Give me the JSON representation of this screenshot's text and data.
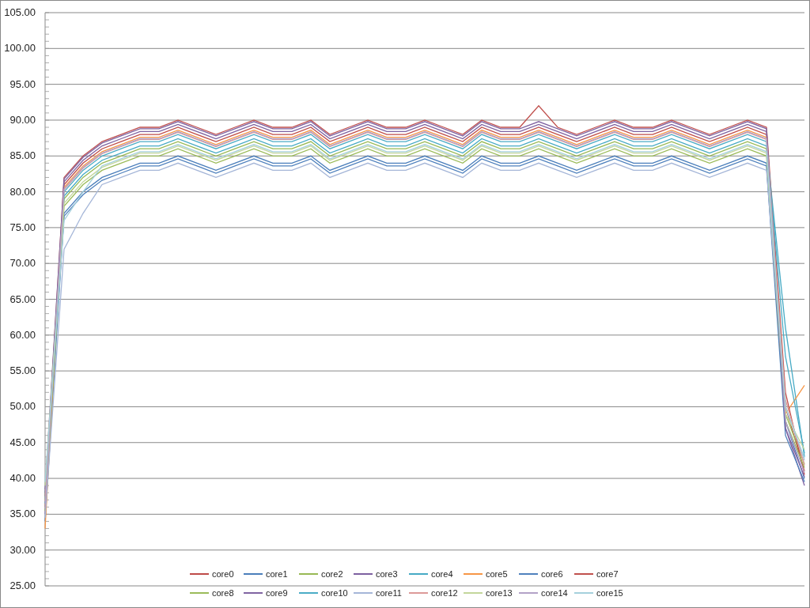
{
  "chart": {
    "chart_data": {
      "type": "line",
      "grid": true,
      "legend": true,
      "ylim": [
        25,
        105
      ],
      "yticks": [
        {
          "value": 25,
          "label": "25.00"
        },
        {
          "value": 30,
          "label": "30.00"
        },
        {
          "value": 35,
          "label": "35.00"
        },
        {
          "value": 40,
          "label": "40.00"
        },
        {
          "value": 45,
          "label": "45.00"
        },
        {
          "value": 50,
          "label": "50.00"
        },
        {
          "value": 55,
          "label": "55.00"
        },
        {
          "value": 60,
          "label": "60.00"
        },
        {
          "value": 65,
          "label": "65.00"
        },
        {
          "value": 70,
          "label": "70.00"
        },
        {
          "value": 75,
          "label": "75.00"
        },
        {
          "value": 80,
          "label": "80.00"
        },
        {
          "value": 85,
          "label": "85.00"
        },
        {
          "value": 90,
          "label": "90.00"
        },
        {
          "value": 95,
          "label": "95.00"
        },
        {
          "value": 100,
          "label": "100.00"
        },
        {
          "value": 105,
          "label": "105.00"
        }
      ],
      "series": [
        {
          "name": "core0",
          "color": "#be4b48",
          "values": [
            36,
            81,
            84,
            86,
            87,
            88,
            88,
            89,
            88,
            87,
            88,
            89,
            88,
            88,
            89,
            87,
            88,
            89,
            88,
            88,
            89,
            88,
            87,
            89,
            88,
            88,
            89,
            88,
            87,
            88,
            89,
            88,
            88,
            89,
            88,
            87,
            88,
            89,
            88,
            50,
            41
          ]
        },
        {
          "name": "core1",
          "color": "#4a7ebb",
          "values": [
            34,
            77,
            80,
            82,
            83,
            84,
            84,
            85,
            84,
            83,
            84,
            85,
            84,
            84,
            85,
            83,
            84,
            85,
            84,
            84,
            85,
            84,
            83,
            85,
            84,
            84,
            85,
            84,
            83,
            84,
            85,
            84,
            84,
            85,
            84,
            83,
            84,
            85,
            84,
            48,
            40
          ]
        },
        {
          "name": "core2",
          "color": "#98b954",
          "values": [
            37,
            79,
            82,
            84,
            85,
            86,
            86,
            87,
            86,
            85,
            86,
            87,
            86,
            86,
            87,
            85,
            86,
            87,
            86,
            86,
            87,
            86,
            85,
            87,
            86,
            86,
            87,
            86,
            85,
            86,
            87,
            86,
            86,
            87,
            86,
            85,
            86,
            87,
            86,
            49,
            42
          ]
        },
        {
          "name": "core3",
          "color": "#7d60a0",
          "values": [
            35,
            81.4,
            84.4,
            86.4,
            87.4,
            88.4,
            88.4,
            89.4,
            88.4,
            87.4,
            88.4,
            89.4,
            88.4,
            88.4,
            89.4,
            87.4,
            88.4,
            89.4,
            88.4,
            88.4,
            89.4,
            88.4,
            87.4,
            89.4,
            88.4,
            88.4,
            89.4,
            88.4,
            87.4,
            88.4,
            89.4,
            88.4,
            88.4,
            89.4,
            88.4,
            87.4,
            88.4,
            89.4,
            88.4,
            47,
            39
          ]
        },
        {
          "name": "core4",
          "color": "#46aac5",
          "values": [
            36.5,
            79.4,
            82.4,
            84.4,
            85.4,
            86.4,
            86.4,
            87.4,
            86.4,
            85.4,
            86.4,
            87.4,
            86.4,
            86.4,
            87.4,
            85.4,
            86.4,
            87.4,
            86.4,
            86.4,
            87.4,
            86.4,
            85.4,
            87.4,
            86.4,
            86.4,
            87.4,
            86.4,
            85.4,
            86.4,
            87.4,
            86.4,
            86.4,
            87.4,
            86.4,
            85.4,
            86.4,
            87.4,
            86.4,
            61,
            43
          ]
        },
        {
          "name": "core5",
          "color": "#f79646",
          "values": [
            33,
            80.6,
            83.6,
            85.6,
            86.6,
            87.6,
            87.6,
            88.6,
            87.6,
            86.6,
            87.6,
            88.6,
            87.6,
            87.6,
            88.6,
            86.6,
            87.6,
            88.6,
            87.6,
            87.6,
            88.6,
            87.6,
            86.6,
            88.6,
            87.6,
            87.6,
            88.6,
            87.6,
            86.6,
            87.6,
            88.6,
            87.6,
            87.6,
            88.6,
            87.6,
            86.6,
            87.6,
            88.6,
            87.6,
            49,
            53
          ]
        },
        {
          "name": "core6",
          "color": "#4f81bd",
          "values": [
            38,
            76.6,
            79.6,
            81.6,
            82.6,
            83.6,
            83.6,
            84.6,
            83.6,
            82.6,
            83.6,
            84.6,
            83.6,
            83.6,
            84.6,
            82.6,
            83.6,
            84.6,
            83.6,
            83.6,
            84.6,
            83.6,
            82.6,
            84.6,
            83.6,
            83.6,
            84.6,
            83.6,
            82.6,
            83.6,
            84.6,
            83.6,
            83.6,
            84.6,
            83.6,
            82.6,
            83.6,
            84.6,
            83.6,
            46,
            39.5
          ]
        },
        {
          "name": "core7",
          "color": "#c0504d",
          "values": [
            37.5,
            82,
            85,
            87,
            88,
            89,
            89,
            90,
            89,
            88,
            89,
            90,
            89,
            89,
            90,
            88,
            89,
            90,
            89,
            89,
            90,
            89,
            88,
            90,
            89,
            89,
            92,
            89,
            88,
            89,
            90,
            89,
            89,
            90,
            89,
            88,
            89,
            90,
            89,
            52,
            40.5
          ]
        },
        {
          "name": "core8",
          "color": "#9bbb59",
          "values": [
            35.5,
            78,
            81,
            83,
            84,
            85,
            85,
            86,
            85,
            84,
            85,
            86,
            85,
            85,
            86,
            84,
            85,
            86,
            85,
            85,
            86,
            85,
            84,
            86,
            85,
            85,
            86,
            85,
            84,
            85,
            86,
            85,
            85,
            86,
            85,
            84,
            85,
            86,
            85,
            48,
            41.5
          ]
        },
        {
          "name": "core9",
          "color": "#8064a2",
          "values": [
            38.5,
            81.8,
            84.8,
            86.8,
            87.8,
            88.8,
            88.8,
            89.8,
            88.8,
            87.8,
            88.8,
            89.8,
            88.8,
            88.8,
            89.8,
            87.8,
            88.8,
            89.8,
            88.8,
            88.8,
            89.8,
            88.8,
            87.8,
            89.8,
            88.8,
            88.8,
            89.8,
            88.8,
            87.8,
            88.8,
            89.8,
            88.8,
            88.8,
            89.8,
            88.8,
            87.8,
            88.8,
            89.8,
            88.8,
            47,
            40.2
          ]
        },
        {
          "name": "core10",
          "color": "#4bacc6",
          "values": [
            37.2,
            80,
            83,
            85,
            86,
            87,
            87,
            88,
            87,
            86,
            87,
            88,
            87,
            87,
            88,
            86,
            87,
            88,
            87,
            87,
            88,
            87,
            86,
            88,
            87,
            87,
            88,
            87,
            86,
            87,
            88,
            87,
            87,
            88,
            87,
            86,
            87,
            88,
            87,
            57,
            43.5
          ]
        },
        {
          "name": "core11",
          "color": "#a5b6d8",
          "values": [
            34.5,
            72,
            77,
            81,
            82,
            83,
            83,
            84,
            83,
            82,
            83,
            84,
            83,
            83,
            84,
            82,
            83,
            84,
            83,
            83,
            84,
            83,
            82,
            84,
            83,
            83,
            84,
            83,
            82,
            83,
            84,
            83,
            83,
            84,
            83,
            82,
            83,
            84,
            83,
            50,
            42.5
          ]
        },
        {
          "name": "core12",
          "color": "#dc9a98",
          "values": [
            36.8,
            80.3,
            83.3,
            85.3,
            86.3,
            87.3,
            87.3,
            88.3,
            87.3,
            86.3,
            87.3,
            88.3,
            87.3,
            87.3,
            88.3,
            86.3,
            87.3,
            88.3,
            87.3,
            87.3,
            88.3,
            87.3,
            86.3,
            88.3,
            87.3,
            87.3,
            88.3,
            87.3,
            86.3,
            87.3,
            88.3,
            87.3,
            87.3,
            88.3,
            87.3,
            86.3,
            87.3,
            88.3,
            87.3,
            51,
            41.8
          ]
        },
        {
          "name": "core13",
          "color": "#c3d69b",
          "values": [
            39,
            78.4,
            81.4,
            83.4,
            84.4,
            85.4,
            85.4,
            86.4,
            85.4,
            84.4,
            85.4,
            86.4,
            85.4,
            85.4,
            86.4,
            84.4,
            85.4,
            86.4,
            85.4,
            85.4,
            86.4,
            85.4,
            84.4,
            86.4,
            85.4,
            85.4,
            86.4,
            85.4,
            84.4,
            85.4,
            86.4,
            85.4,
            85.4,
            86.4,
            85.4,
            84.4,
            85.4,
            86.4,
            85.4,
            49,
            44
          ]
        },
        {
          "name": "core14",
          "color": "#b3a2c7",
          "values": [
            35.8,
            80.4,
            83.4,
            85.4,
            86.4,
            87.4,
            87.4,
            88.4,
            87.4,
            86.4,
            87.4,
            88.4,
            87.4,
            87.4,
            88.4,
            86.4,
            87.4,
            88.4,
            87.4,
            87.4,
            88.4,
            87.4,
            86.4,
            88.4,
            87.4,
            87.4,
            88.4,
            87.4,
            86.4,
            87.4,
            88.4,
            87.4,
            87.4,
            88.4,
            87.4,
            86.4,
            87.4,
            88.4,
            87.4,
            48,
            40.8
          ]
        },
        {
          "name": "core15",
          "color": "#a5d0dc",
          "values": [
            39.5,
            76,
            80,
            83.6,
            84.6,
            85.6,
            85.6,
            86.6,
            85.6,
            84.6,
            85.6,
            86.6,
            85.6,
            85.6,
            86.6,
            84.6,
            85.6,
            86.6,
            85.6,
            85.6,
            86.6,
            85.6,
            84.6,
            86.6,
            85.6,
            85.6,
            86.6,
            85.6,
            84.6,
            85.6,
            86.6,
            85.6,
            85.6,
            86.6,
            85.6,
            84.6,
            85.6,
            86.6,
            85.6,
            50,
            42.8
          ]
        }
      ]
    }
  }
}
